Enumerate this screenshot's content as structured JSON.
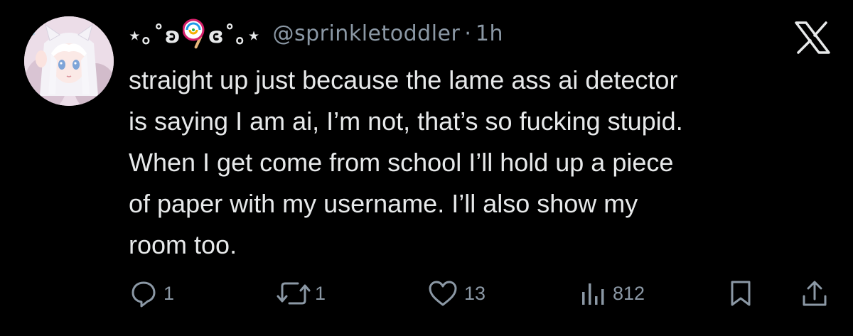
{
  "tweet": {
    "display_name_left": "⋆｡˚ʚ",
    "display_name_right": "ɞ˚｡⋆",
    "handle": "@sprinkletoddler",
    "separator": "·",
    "time": "1h",
    "text_lines": [
      "straight up just because the lame ass ai detector",
      "is saying I am ai, I’m not, that’s so fucking stupid.",
      "When I get come from school I’ll hold up a piece",
      "of paper with my username. I’ll also show my",
      "room too."
    ]
  },
  "actions": {
    "reply_count": "1",
    "retweet_count": "1",
    "like_count": "13",
    "views_count": "812"
  },
  "colors": {
    "background": "#000000",
    "text": "#e7e9ea",
    "muted": "#8b98a5"
  },
  "icons": {
    "avatar": "anime-girl-avatar",
    "emoji": "lollipop-icon",
    "brand": "x-logo-icon",
    "reply": "reply-icon",
    "retweet": "retweet-icon",
    "like": "heart-icon",
    "views": "views-icon",
    "bookmark": "bookmark-icon",
    "share": "share-icon"
  }
}
